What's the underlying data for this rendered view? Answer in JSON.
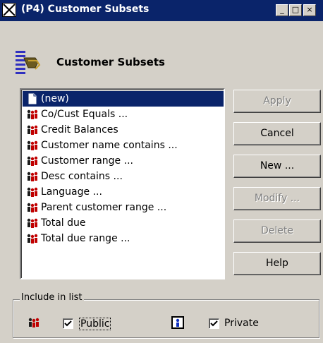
{
  "window": {
    "title": "(P4) Customer Subsets",
    "controls": {
      "minimize": "_",
      "maximize": "□",
      "close": "×"
    }
  },
  "header": {
    "title": "Customer Subsets",
    "icon": "subsets-list-icon"
  },
  "subsets": [
    {
      "label": "(new)",
      "icon": "new-document-icon",
      "selected": true
    },
    {
      "label": "Co/Cust Equals ...",
      "icon": "people-icon",
      "selected": false
    },
    {
      "label": "Credit Balances",
      "icon": "people-icon",
      "selected": false
    },
    {
      "label": "Customer name contains ...",
      "icon": "people-icon",
      "selected": false
    },
    {
      "label": "Customer range ...",
      "icon": "people-icon",
      "selected": false
    },
    {
      "label": "Desc contains ...",
      "icon": "people-icon",
      "selected": false
    },
    {
      "label": "Language ...",
      "icon": "people-icon",
      "selected": false
    },
    {
      "label": "Parent customer range ...",
      "icon": "people-icon",
      "selected": false
    },
    {
      "label": "Total due",
      "icon": "people-icon",
      "selected": false
    },
    {
      "label": "Total due range ...",
      "icon": "people-icon",
      "selected": false
    }
  ],
  "buttons": {
    "apply": "Apply",
    "cancel": "Cancel",
    "new": "New ...",
    "modify": "Modify ...",
    "delete": "Delete",
    "help": "Help"
  },
  "include_group": {
    "legend": "Include in list",
    "public": {
      "label": "Public",
      "checked": true,
      "icon": "people-icon"
    },
    "private": {
      "label": "Private",
      "checked": true,
      "icon": "single-person-icon"
    }
  },
  "colors": {
    "selection": "#0a246a",
    "titlebar": "#0a246a",
    "face": "#d4d0c8"
  }
}
